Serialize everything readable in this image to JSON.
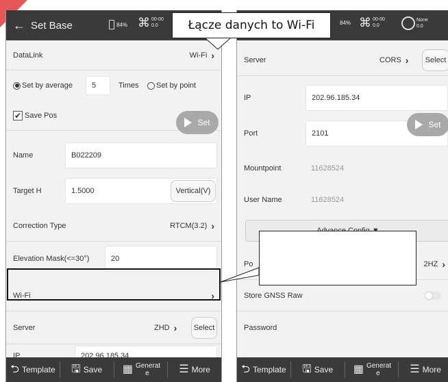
{
  "callouts": {
    "top_text": "Łącze danych to Wi-Fi",
    "middle_text": ""
  },
  "left_screen": {
    "status": {
      "back_glyph": "←",
      "title": "Set Base",
      "battery": "84%",
      "sat_line1": "00-00",
      "sat_line2": "0.0"
    },
    "datalink": {
      "label": "DataLink",
      "value": "Wi-Fi"
    },
    "method": {
      "avg_label": "Set by average",
      "avg_count": "5",
      "times_label": "Times",
      "point_label": "Set by point"
    },
    "save_pos": {
      "label": "Save Pos",
      "check_glyph": "✔"
    },
    "set_button": "Set",
    "name": {
      "label": "Name",
      "value": "B022209"
    },
    "target_h": {
      "label": "Target H",
      "value": "1.5000",
      "mode_button": "Vertical(V)"
    },
    "correction": {
      "label": "Correction Type",
      "value": "RTCM(3.2)"
    },
    "elevation": {
      "label": "Elevation Mask(<=30°)",
      "value": "20"
    },
    "wifi": {
      "label": "Wi-Fi"
    },
    "server": {
      "label": "Server",
      "value": "ZHD",
      "select_button": "Select"
    },
    "ip": {
      "label": "IP",
      "value": "202.96.185.34"
    }
  },
  "right_screen": {
    "status": {
      "battery": "84%",
      "sat_line1": "00-00",
      "sat_line2": "0.0",
      "none_line1": "None",
      "none_line2": "0.0"
    },
    "server": {
      "label": "Server",
      "value": "CORS",
      "select_button": "Select"
    },
    "ip": {
      "label": "IP",
      "value": "202.96.185.34"
    },
    "port": {
      "label": "Port",
      "value": "2101"
    },
    "set_button": "Set",
    "mountpoint": {
      "label": "Mountpoint",
      "value": "11628524"
    },
    "username": {
      "label": "User Name",
      "value": "11628524"
    },
    "advance_button": "Advance Config ▼",
    "po_row": {
      "label_partial": "Po",
      "value_partial": "2HZ"
    },
    "store_raw": {
      "label": "Store GNSS Raw"
    },
    "password": {
      "label": "Password"
    }
  },
  "bottom_bar": {
    "template": "Template",
    "save": "Save",
    "generate": "Generat e",
    "more": "More"
  },
  "icons": {
    "back": "back-arrow-icon",
    "template": "template-icon",
    "save": "floppy-disk-icon",
    "generate": "qr-code-icon",
    "more": "menu-icon"
  }
}
